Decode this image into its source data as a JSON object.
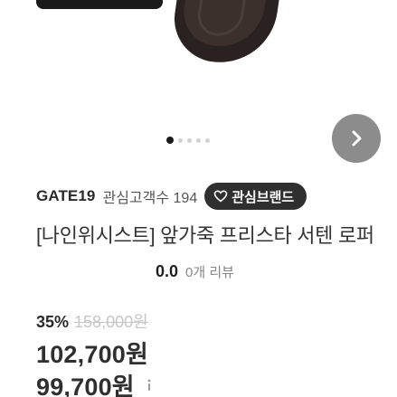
{
  "hero": {
    "slide_count": 5,
    "active_slide": 1
  },
  "seller": {
    "name": "GATE19",
    "follower_text": "관심고객수 194",
    "follow_label": "관심브랜드"
  },
  "product": {
    "title": "[나인위시스트] 앞가죽 프리스타 서텐 로퍼",
    "rating_score": "0.0",
    "rating_label": "0개 리뷰",
    "discount": "35%",
    "original_price": "158,000원",
    "price": "102,700원",
    "member_price": "99,700원"
  },
  "colors": {
    "follow_bg": "#2f2f2f",
    "more_bg": "#8c8c8c",
    "strike": "#c6c6c6"
  },
  "icons": {
    "more": "chevron-right-icon",
    "follow": "heart-icon",
    "info": "info-icon"
  }
}
